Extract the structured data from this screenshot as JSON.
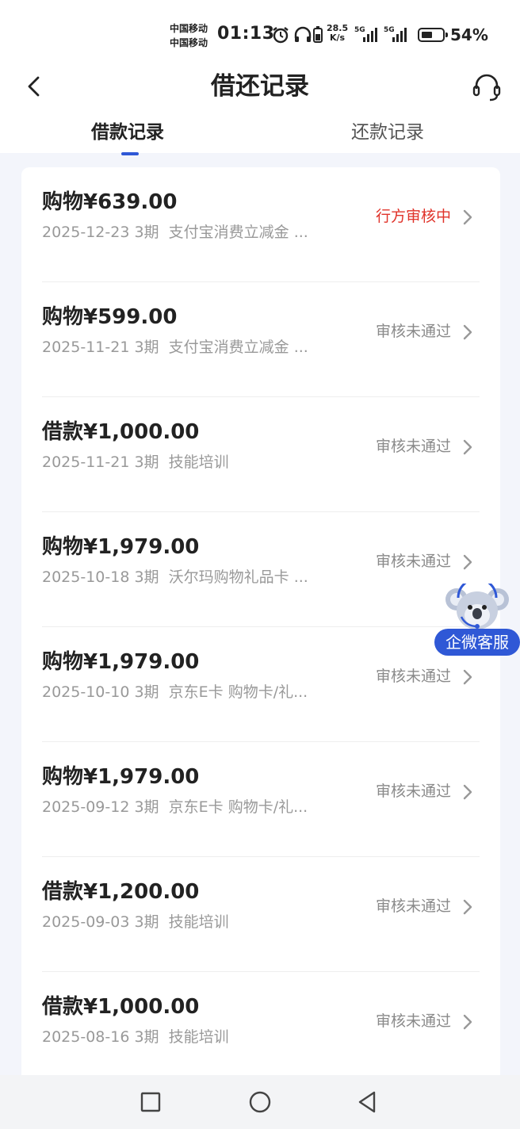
{
  "status_bar": {
    "carrier_1": "中国移动",
    "carrier_2": "中国移动",
    "time": "01:13",
    "net_speed_value": "28.5",
    "net_speed_unit": "K/s",
    "sim1_label": "5G",
    "sim2_label": "5G",
    "battery_percent": "54%",
    "battery_level": 0.54
  },
  "header": {
    "title": "借还记录",
    "back_icon": "chevron-left-icon",
    "support_icon": "headset-icon"
  },
  "tabs": [
    {
      "label": "借款记录",
      "active": true
    },
    {
      "label": "还款记录",
      "active": false
    }
  ],
  "records": [
    {
      "amount": "购物¥639.00",
      "date_term": "2025-12-23 3期",
      "desc": "支付宝消费立减金 ...",
      "status": "行方审核中",
      "status_type": "reviewing"
    },
    {
      "amount": "购物¥599.00",
      "date_term": "2025-11-21 3期",
      "desc": "支付宝消费立减金 ...",
      "status": "审核未通过",
      "status_type": "rejected"
    },
    {
      "amount": "借款¥1,000.00",
      "date_term": "2025-11-21 3期",
      "desc": "技能培训",
      "status": "审核未通过",
      "status_type": "rejected"
    },
    {
      "amount": "购物¥1,979.00",
      "date_term": "2025-10-18 3期",
      "desc": "沃尔玛购物礼品卡 ...",
      "status": "审核未通过",
      "status_type": "rejected"
    },
    {
      "amount": "购物¥1,979.00",
      "date_term": "2025-10-10 3期",
      "desc": "京东E卡 购物卡/礼...",
      "status": "审核未通过",
      "status_type": "rejected"
    },
    {
      "amount": "购物¥1,979.00",
      "date_term": "2025-09-12 3期",
      "desc": "京东E卡 购物卡/礼...",
      "status": "审核未通过",
      "status_type": "rejected"
    },
    {
      "amount": "借款¥1,200.00",
      "date_term": "2025-09-03 3期",
      "desc": "技能培训",
      "status": "审核未通过",
      "status_type": "rejected"
    },
    {
      "amount": "借款¥1,000.00",
      "date_term": "2025-08-16 3期",
      "desc": "技能培训",
      "status": "审核未通过",
      "status_type": "rejected"
    }
  ],
  "floating_service": {
    "label": "企微客服",
    "icon": "koala-mascot-icon"
  },
  "nav_bar": {
    "recents_icon": "square-icon",
    "home_icon": "circle-icon",
    "back_icon": "triangle-back-icon"
  },
  "colors": {
    "accent": "#2f58d6",
    "reviewing": "#e0332a",
    "muted": "#999999",
    "background": "#f3f5fb"
  }
}
